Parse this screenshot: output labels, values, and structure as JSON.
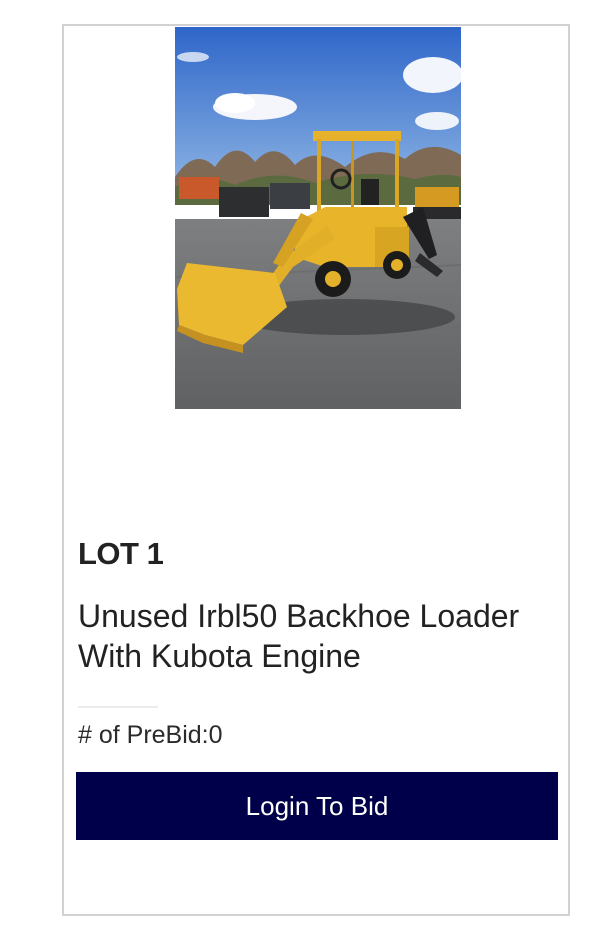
{
  "lot": {
    "number_label": "LOT 1",
    "title": "Unused Irbl50 Backhoe Loader With Kubota Engine",
    "prebid_label": "# of PreBid:",
    "prebid_count": "0",
    "photo_alt": "Unused Irbl50 Backhoe Loader With Kubota Engine"
  },
  "actions": {
    "login_to_bid_label": "Login To Bid"
  },
  "colors": {
    "button_background": "#00004a",
    "button_text": "#ffffff",
    "card_border": "#d2d2d2",
    "machine_yellow": "#e8b52a"
  }
}
